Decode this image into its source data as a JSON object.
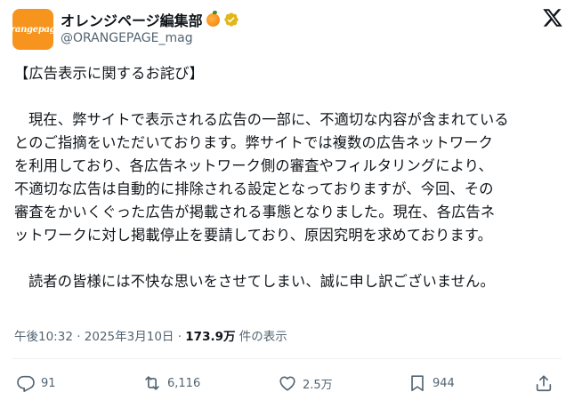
{
  "account": {
    "display_name": "オレンジページ編集部",
    "handle": "@ORANGEPAGE_mag",
    "avatar_text": "orangepage",
    "emoji": "orange",
    "verified": true
  },
  "post": {
    "lines": [
      "【広告表示に関するお詫び】",
      "",
      "現在、弊サイトで表示される広告の一部に、不適切な内容が含まれている",
      "とのご指摘をいただいております。弊サイトでは複数の広告ネットワーク",
      "を利用しており、各広告ネットワーク側の審査やフィルタリングにより、",
      "不適切な広告は自動的に排除される設定となっておりますが、今回、その",
      "審査をかいくぐった広告が掲載される事態となりました。現在、各広告ネ",
      "ットワークに対し掲載停止を要請しており、原因究明を求めております。",
      "",
      "読者の皆様には不快な思いをさせてしまい、誠に申し訳ございません。"
    ],
    "timestamp": "午後10:32 · 2025年3月10日 · ",
    "views_count": "173.9万",
    "views_label": " 件の表示"
  },
  "actions": {
    "replies": "91",
    "reposts": "6,116",
    "likes": "2.5万",
    "bookmarks": "944"
  },
  "colors": {
    "brand_orange": "#f7941d",
    "verified_gold": "#e2b719",
    "secondary_text": "#536471",
    "primary_text": "#0f1419"
  }
}
